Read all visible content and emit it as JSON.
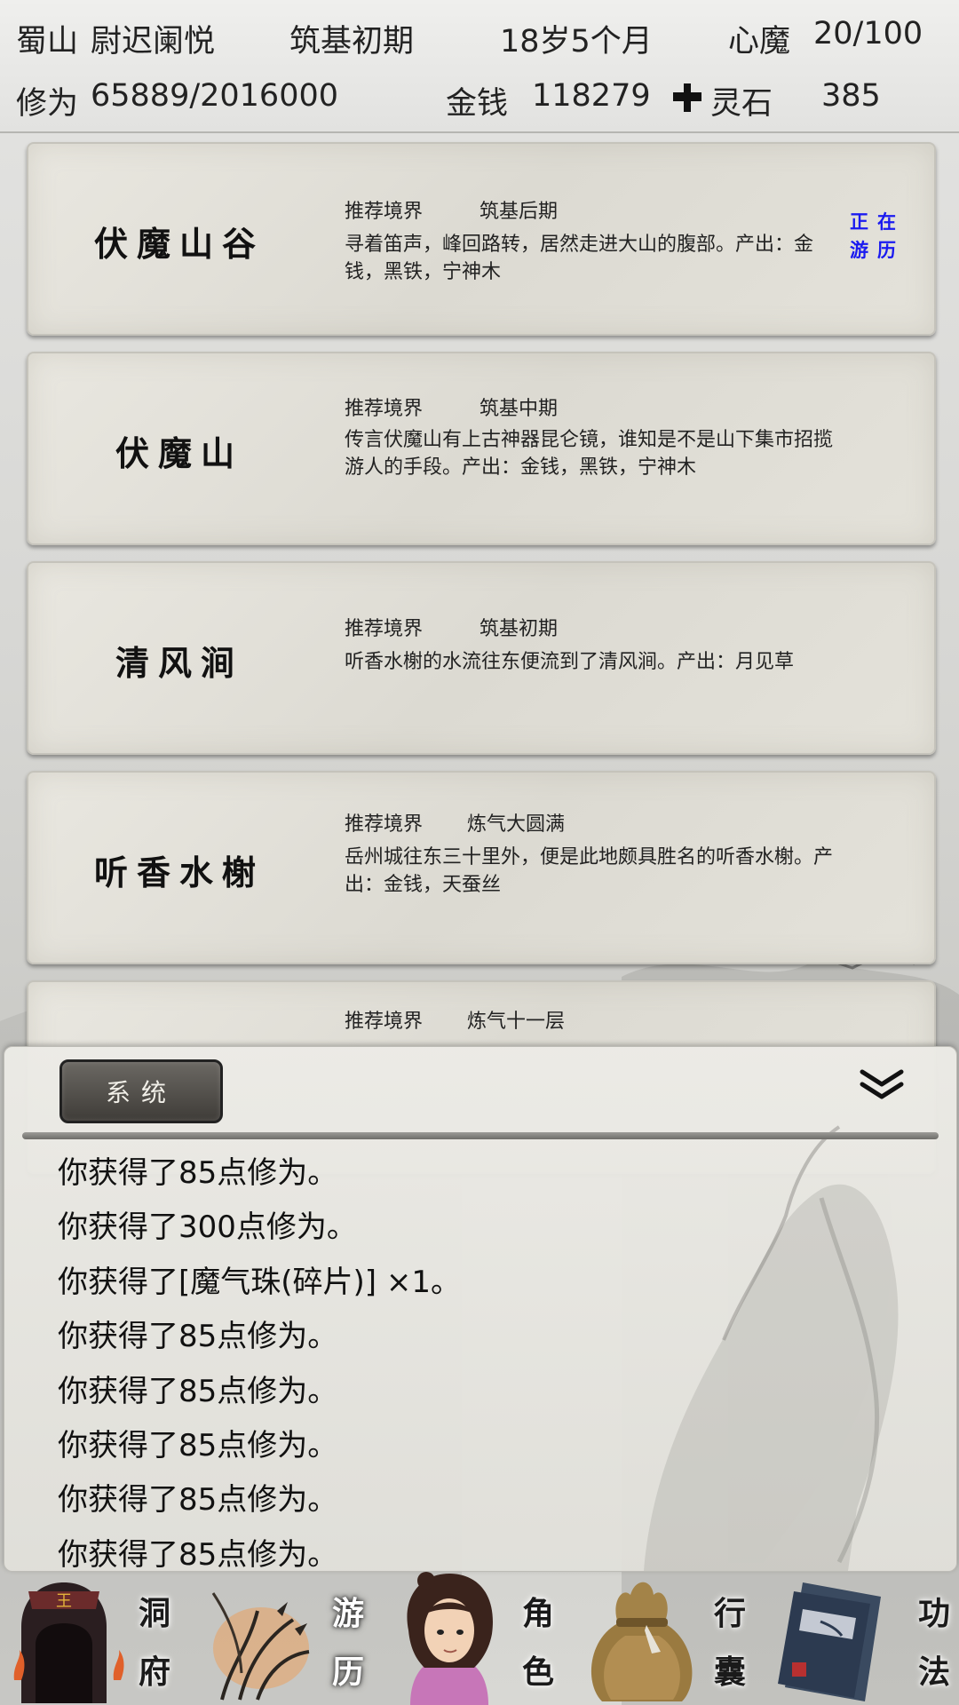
{
  "header": {
    "sect": "蜀山",
    "character_name": "尉迟阑悦",
    "realm": "筑基初期",
    "age": "18岁5个月",
    "demon_label": "心魔",
    "demon_value": "20/100",
    "cultivation_label": "修为",
    "cultivation_value": "65889/2016000",
    "money_label": "金钱",
    "money_value": "118279",
    "spirit_stone_label": "灵石",
    "spirit_stone_value": "385"
  },
  "locations": [
    {
      "name": "伏魔山谷",
      "realm_label": "推荐境界",
      "realm_value": "筑基后期",
      "description": "寻着笛声，峰回路转，居然走进大山的腹部。产出：金钱，黑铁，宁神木",
      "status": "正在游历"
    },
    {
      "name": "伏魔山",
      "realm_label": "推荐境界",
      "realm_value": "筑基中期",
      "description": "传言伏魔山有上古神器昆仑镜，谁知是不是山下集市招揽游人的手段。产出：金钱，黑铁，宁神木"
    },
    {
      "name": "清风涧",
      "realm_label": "推荐境界",
      "realm_value": "筑基初期",
      "description": "听香水榭的水流往东便流到了清风涧。产出：月见草"
    },
    {
      "name": "听香水榭",
      "realm_label": "推荐境界",
      "realm_value": "炼气大圆满",
      "description": "岳州城往东三十里外，便是此地颇具胜名的听香水榭。产出：金钱，天蚕丝"
    },
    {
      "name": "",
      "realm_label": "推荐境界",
      "realm_value": "炼气十一层",
      "description": ""
    }
  ],
  "log": {
    "tab_label": "系统",
    "lines": [
      "你获得了85点修为。",
      "你获得了300点修为。",
      "你获得了[魔气珠(碎片)] ×1。",
      "你获得了85点修为。",
      "你获得了85点修为。",
      "你获得了85点修为。",
      "你获得了85点修为。",
      "你获得了85点修为。"
    ]
  },
  "nav": [
    {
      "label_top": "洞",
      "label_bottom": "府",
      "icon": "cave-dwelling-icon"
    },
    {
      "label_top": "游",
      "label_bottom": "历",
      "icon": "travel-icon",
      "selected": true
    },
    {
      "label_top": "角",
      "label_bottom": "色",
      "icon": "character-icon"
    },
    {
      "label_top": "行",
      "label_bottom": "囊",
      "icon": "bag-icon"
    },
    {
      "label_top": "功",
      "label_bottom": "法",
      "icon": "scripture-icon"
    }
  ],
  "colors": {
    "status_text": "#1a1af0",
    "log_tab_bg": "#4a4743",
    "card_bg": "#e3e1d9"
  }
}
